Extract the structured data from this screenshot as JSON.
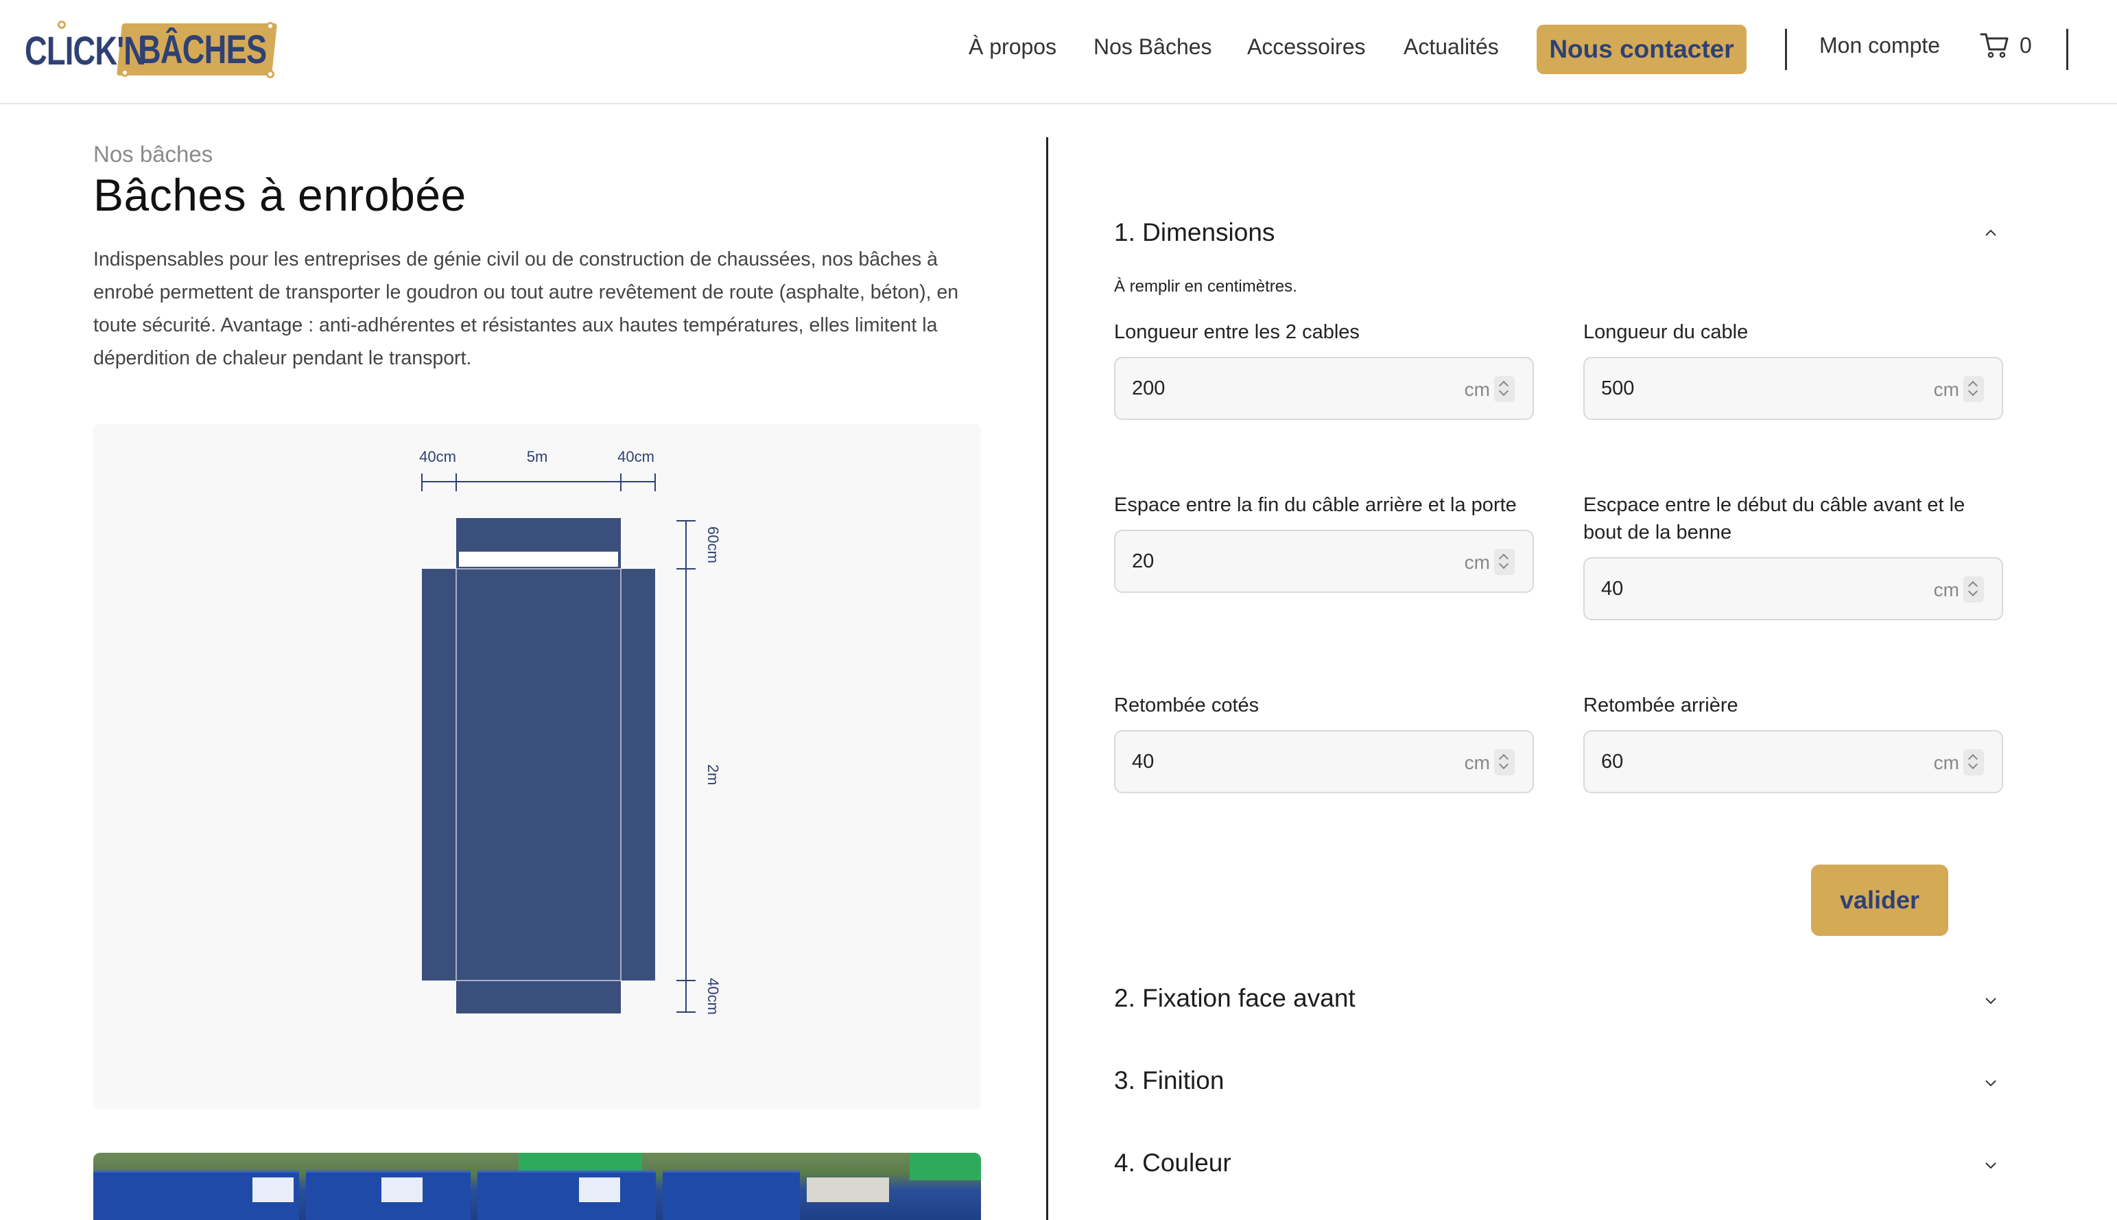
{
  "header": {
    "logo": "CLICK'N BÂCHES",
    "logo_left": "CLICK'N",
    "logo_right": "BÂCHES",
    "nav": [
      "À propos",
      "Nos Bâches",
      "Accessoires",
      "Actualités"
    ],
    "contact_label": "Nous contacter",
    "account_label": "Mon compte",
    "cart_count": "0",
    "cart_icon": "cart-icon"
  },
  "product": {
    "breadcrumb": "Nos bâches",
    "title": "Bâches à enrobée",
    "description": "Indispensables pour les entreprises de génie civil ou de construction de chaussées, nos bâches à enrobé permettent de transporter le goudron ou tout autre revêtement de route (asphalte, béton), en toute sécurité. Avantage : anti-adhérentes et résistantes aux hautes températures, elles limitent la déperdition de chaleur pendant le transport."
  },
  "diagram": {
    "top_labels": [
      "40cm",
      "5m",
      "40cm"
    ],
    "side_labels": [
      "60cm",
      "2m",
      "40cm"
    ],
    "tarp_color": "#3b4f7c"
  },
  "config": {
    "sections": [
      {
        "label": "1. Dimensions",
        "expanded": true
      },
      {
        "label": "2. Fixation face avant",
        "expanded": false
      },
      {
        "label": "3. Finition",
        "expanded": false
      },
      {
        "label": "4. Couleur",
        "expanded": false
      }
    ],
    "note": "À remplir en centimètres.",
    "unit": "cm",
    "fields": [
      {
        "label": "Longueur entre les 2 cables",
        "value": "200"
      },
      {
        "label": "Longueur du cable",
        "value": "500"
      },
      {
        "label": "Espace entre la fin du câble arrière et la porte",
        "value": "20"
      },
      {
        "label": "Escpace entre le début du câble avant et le bout de la benne",
        "value": "40"
      },
      {
        "label": "Retombée cotés",
        "value": "40"
      },
      {
        "label": "Retombée arrière",
        "value": "60"
      }
    ],
    "submit_label": "valider"
  },
  "colors": {
    "accent": "#d4aa57",
    "brand_blue": "#2f4174"
  }
}
